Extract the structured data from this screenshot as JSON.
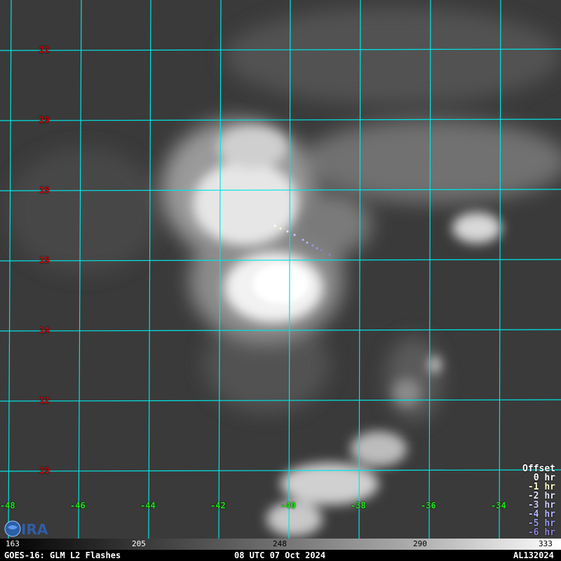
{
  "map": {
    "latitudes": [
      "22",
      "20",
      "18",
      "16",
      "14",
      "12",
      "10"
    ],
    "longitudes": [
      "-48",
      "-46",
      "-44",
      "-42",
      "-40",
      "-38",
      "-36",
      "-34"
    ],
    "grid_color": "#00e5e5",
    "lat_label_color": "#d40000",
    "lon_label_color": "#19e619"
  },
  "legend": {
    "title": "Offset",
    "entries": [
      {
        "label": "0 hr",
        "color": "#ffffff"
      },
      {
        "label": "-1 hr",
        "color": "#ffffcc"
      },
      {
        "label": "-2 hr",
        "color": "#e6e6ff"
      },
      {
        "label": "-3 hr",
        "color": "#ccccff"
      },
      {
        "label": "-4 hr",
        "color": "#b3b3ff"
      },
      {
        "label": "-5 hr",
        "color": "#9999ee"
      },
      {
        "label": "-6 hr",
        "color": "#8f7fd9"
      }
    ]
  },
  "colorbar": {
    "ticks": [
      "163",
      "205",
      "248",
      "290",
      "333"
    ]
  },
  "footer": {
    "left": "GOES-16: GLM L2 Flashes",
    "center": "08 UTC 07 Oct 2024",
    "right": "AL132024"
  },
  "logo": {
    "icon": "cira-logo"
  }
}
